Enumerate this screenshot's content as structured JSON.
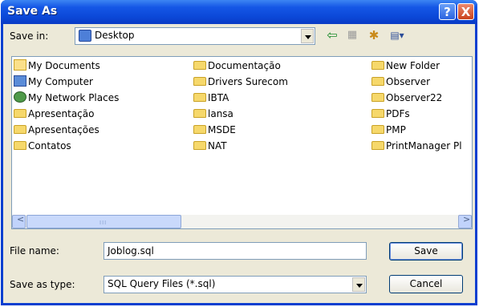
{
  "window": {
    "title": "Save As"
  },
  "titlebar": {
    "help_glyph": "?",
    "close_glyph": "X"
  },
  "savein": {
    "label": "Save in:",
    "value": "Desktop"
  },
  "toolbar": {
    "back_glyph": "⇦",
    "up_glyph": "▦",
    "newfolder_glyph": "✱",
    "views_glyph": "▤▾"
  },
  "files": {
    "col1": [
      "My Documents",
      "My Computer",
      "My Network Places",
      "Apresentação",
      "Apresentações",
      "Contatos"
    ],
    "col2": [
      "Documentação",
      "Drivers Surecom",
      "IBTA",
      "lansa",
      "MSDE",
      "NAT"
    ],
    "col3": [
      "New Folder",
      "Observer",
      "Observer22",
      "PDFs",
      "PMP",
      "PrintManager Pl"
    ]
  },
  "scroll": {
    "left": "<",
    "right": ">",
    "grip": "III"
  },
  "filename": {
    "label": "File name:",
    "value": "Joblog.sql"
  },
  "savetype": {
    "label": "Save as type:",
    "value": "SQL Query Files (*.sql)"
  },
  "buttons": {
    "save": "Save",
    "cancel": "Cancel"
  },
  "colors": {
    "title_blue": "#0a3fd0",
    "face": "#ece9d8",
    "close_red": "#c9421c"
  }
}
